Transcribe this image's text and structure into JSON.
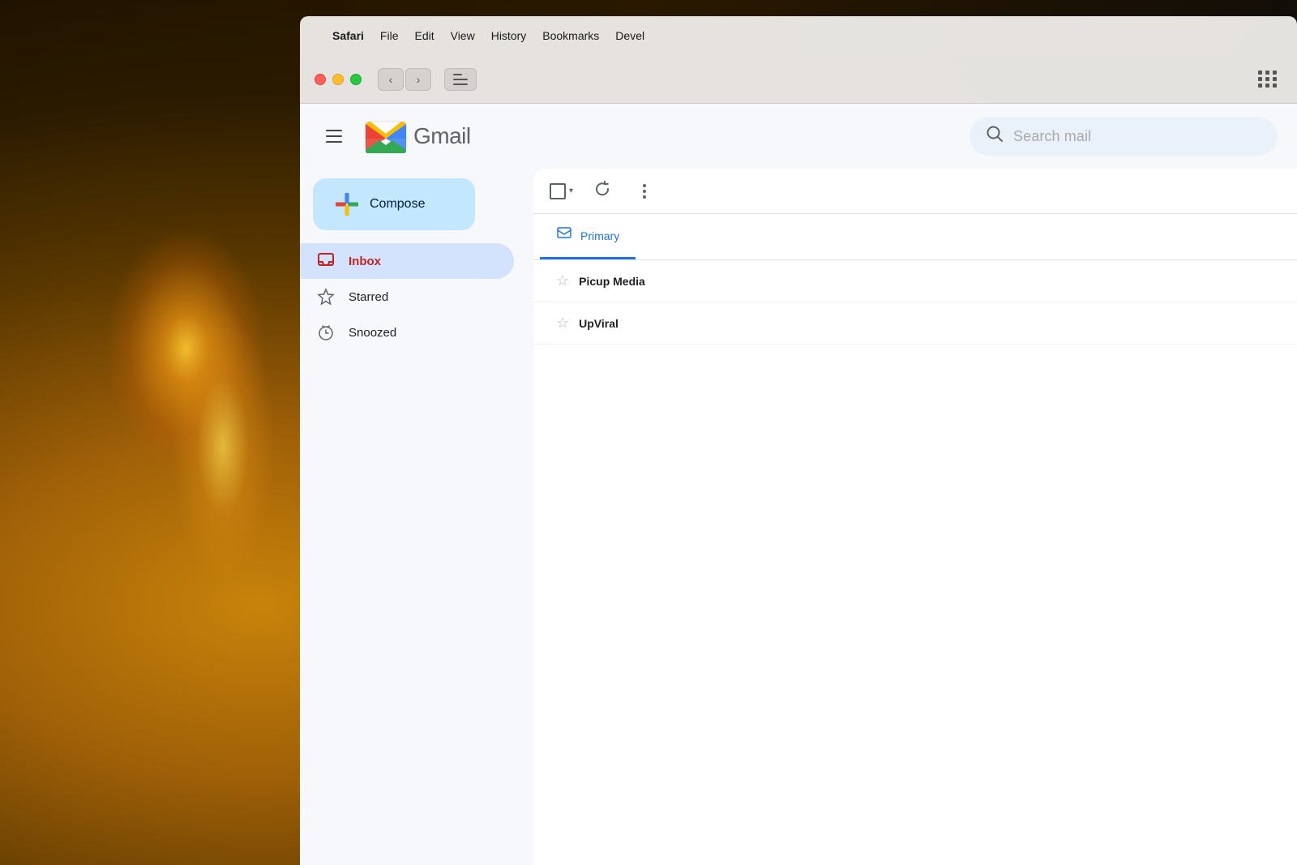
{
  "background": {
    "description": "Dark background with warm glowing light bulbs on left side"
  },
  "menubar": {
    "apple_symbol": "",
    "items": [
      {
        "label": "Safari",
        "bold": true
      },
      {
        "label": "File"
      },
      {
        "label": "Edit"
      },
      {
        "label": "View"
      },
      {
        "label": "History"
      },
      {
        "label": "Bookmarks"
      },
      {
        "label": "Devel"
      }
    ]
  },
  "safari_toolbar": {
    "back_arrow": "‹",
    "forward_arrow": "›"
  },
  "gmail": {
    "title": "Gmail",
    "search_placeholder": "Search mail",
    "compose_label": "Compose",
    "nav_items": [
      {
        "id": "inbox",
        "label": "Inbox",
        "active": true,
        "icon": "inbox"
      },
      {
        "id": "starred",
        "label": "Starred",
        "active": false,
        "icon": "star"
      },
      {
        "id": "snoozed",
        "label": "Snoozed",
        "active": false,
        "icon": "clock"
      }
    ],
    "tabs": [
      {
        "id": "primary",
        "label": "Primary",
        "active": true
      }
    ],
    "email_rows": [
      {
        "sender": "Picup Media",
        "starred": false
      },
      {
        "sender": "UpViral",
        "starred": false
      }
    ]
  },
  "icons": {
    "hamburger": "≡",
    "search": "🔍",
    "checkbox": "□",
    "refresh": "↻",
    "more": "⋮",
    "star_empty": "☆",
    "inbox_icon": "📥",
    "primary_icon": "🏷"
  }
}
